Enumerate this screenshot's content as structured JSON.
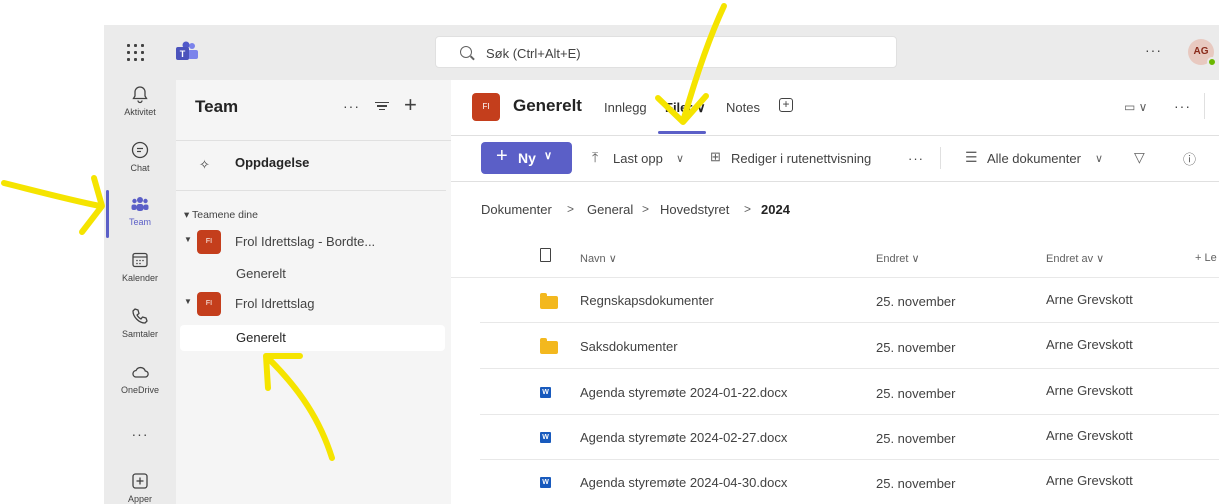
{
  "topbar": {
    "search_placeholder": "Søk (Ctrl+Alt+E)",
    "more": "···",
    "avatar_initials": "AG"
  },
  "rail": {
    "items": [
      {
        "label": "Aktivitet",
        "icon": "bell-icon"
      },
      {
        "label": "Chat",
        "icon": "chat-icon"
      },
      {
        "label": "Team",
        "icon": "people-icon"
      },
      {
        "label": "Kalender",
        "icon": "calendar-icon"
      },
      {
        "label": "Samtaler",
        "icon": "phone-icon"
      },
      {
        "label": "OneDrive",
        "icon": "cloud-icon"
      }
    ],
    "more": "···",
    "apps_label": "Apper"
  },
  "panel": {
    "title": "Team",
    "more": "···",
    "discover": "Oppdagelse",
    "group_label": "Teamene dine",
    "teams": [
      {
        "avatar": "FI",
        "name": "Frol Idrettslag - Bordte...",
        "channel": "Generelt"
      },
      {
        "avatar": "FI",
        "name": "Frol Idrettslag",
        "channel": "Generelt"
      }
    ]
  },
  "main": {
    "channel_avatar": "FI",
    "channel_title": "Generelt",
    "tabs": [
      {
        "label": "Innlegg"
      },
      {
        "label": "Filer ∨"
      },
      {
        "label": "Notes"
      }
    ],
    "more": "···"
  },
  "toolbar": {
    "new_label": "Ny",
    "upload": "Last opp",
    "grid_edit": "Rediger i rutenettvisning",
    "more": "···",
    "view": "Alle dokumenter"
  },
  "breadcrumb": [
    "Dokumenter",
    "General",
    "Hovedstyret",
    "2024"
  ],
  "table": {
    "headers": {
      "name": "Navn",
      "modified": "Endret",
      "modified_by": "Endret av",
      "add_column": "+ Le"
    },
    "rows": [
      {
        "type": "folder",
        "name": "Regnskapsdokumenter",
        "modified": "25. november",
        "modified_by": "Arne Grevskott"
      },
      {
        "type": "folder",
        "name": "Saksdokumenter",
        "modified": "25. november",
        "modified_by": "Arne Grevskott"
      },
      {
        "type": "docx",
        "name": "Agenda styremøte 2024-01-22.docx",
        "modified": "25. november",
        "modified_by": "Arne Grevskott"
      },
      {
        "type": "docx",
        "name": "Agenda styremøte 2024-02-27.docx",
        "modified": "25. november",
        "modified_by": "Arne Grevskott"
      },
      {
        "type": "docx",
        "name": "Agenda styremøte 2024-04-30.docx",
        "modified": "25. november",
        "modified_by": "Arne Grevskott"
      }
    ]
  },
  "colors": {
    "accent": "#5b5fc7",
    "team_avatar": "#c43e1c",
    "annotation_arrow": "#f5e400"
  }
}
